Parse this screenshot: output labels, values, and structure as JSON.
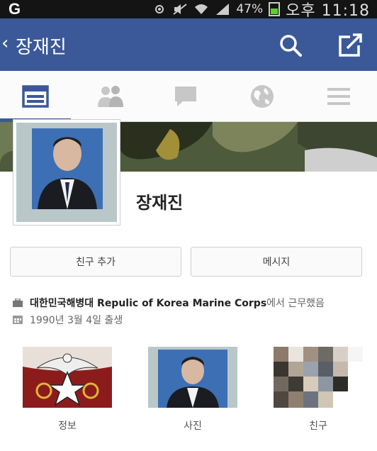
{
  "status_bar": {
    "battery_percent": "47%",
    "time": "오후 11:18"
  },
  "app_bar": {
    "back_chevron": "‹",
    "title": "장재진",
    "color": "#3b5998"
  },
  "tabs": [
    {
      "icon": "timeline-icon",
      "active": true
    },
    {
      "icon": "friends-icon",
      "active": false
    },
    {
      "icon": "messages-icon",
      "active": false
    },
    {
      "icon": "globe-icon",
      "active": false
    },
    {
      "icon": "menu-icon",
      "active": false
    }
  ],
  "profile": {
    "name": "장재진"
  },
  "actions": {
    "add_friend_label": "친구 추가",
    "message_label": "메시지"
  },
  "info": {
    "work_org": "대한민국해병대 Repulic of Korea Marine Corps",
    "work_suffix": "에서 근무했음",
    "birthday": "1990년 3월 4일 출생"
  },
  "thumbnails": [
    {
      "label": "정보"
    },
    {
      "label": "사진"
    },
    {
      "label": "친구"
    }
  ]
}
